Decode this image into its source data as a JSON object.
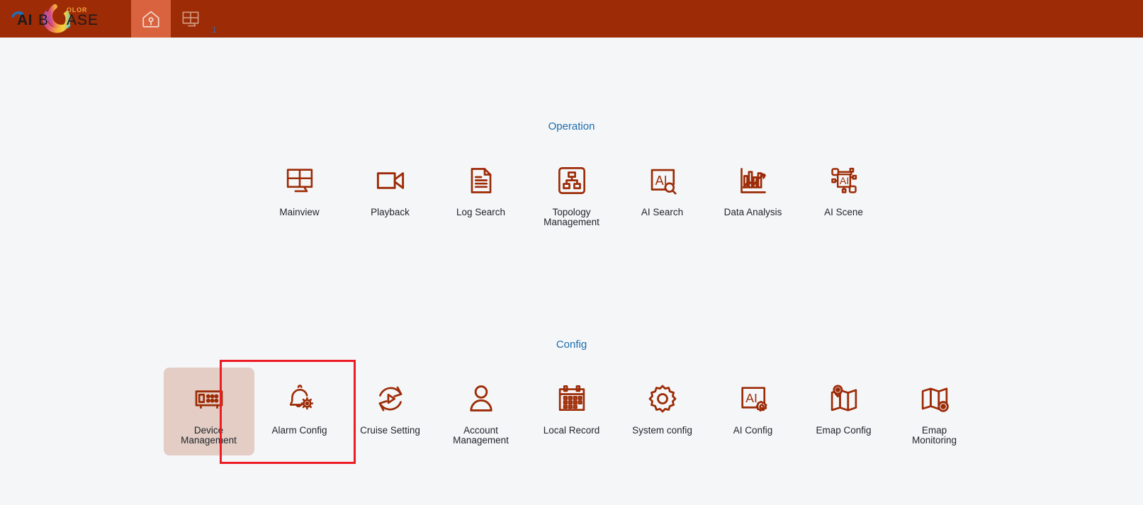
{
  "app": {
    "brand_primary": "#9c2b06",
    "brand_active_tab": "#d9633f",
    "accent_heading": "#1b6daf",
    "icon_color": "#9c2b06",
    "page_background": "#f5f6f8",
    "highlight_tile_bg": "#e3cdc4",
    "annotation_color": "#ed1c24",
    "logo_text_main": "AIBASE",
    "logo_text_sub": "OLOR"
  },
  "topbar": {
    "tabs": [
      {
        "name": "home-tab",
        "icon": "home-icon",
        "active": true,
        "badge": ""
      },
      {
        "name": "mainview-tab",
        "icon": "grid-monitor-icon",
        "active": false,
        "badge": "1"
      }
    ]
  },
  "sections": [
    {
      "id": "operation",
      "title": "Operation",
      "tiles": [
        {
          "label": "Mainview",
          "icon": "grid-monitor-icon",
          "highlight": false
        },
        {
          "label": "Playback",
          "icon": "video-camera-icon",
          "highlight": false
        },
        {
          "label": "Log Search",
          "icon": "document-lines-icon",
          "highlight": false
        },
        {
          "label": "Topology\nManagement",
          "icon": "topology-icon",
          "highlight": false
        },
        {
          "label": "AI Search",
          "icon": "ai-search-icon",
          "highlight": false
        },
        {
          "label": "Data Analysis",
          "icon": "data-analysis-icon",
          "highlight": false
        },
        {
          "label": "AI Scene",
          "icon": "ai-scene-icon",
          "highlight": false
        }
      ]
    },
    {
      "id": "config",
      "title": "Config",
      "tiles": [
        {
          "label": "Device\nManagement",
          "icon": "device-rack-icon",
          "highlight": true
        },
        {
          "label": "Alarm Config",
          "icon": "bell-gear-icon",
          "highlight": false
        },
        {
          "label": "Cruise Setting",
          "icon": "cruise-play-icon",
          "highlight": false
        },
        {
          "label": "Account\nManagement",
          "icon": "person-icon",
          "highlight": false
        },
        {
          "label": "Local Record",
          "icon": "calendar-icon",
          "highlight": false
        },
        {
          "label": "System config",
          "icon": "gear-icon",
          "highlight": false
        },
        {
          "label": "AI Config",
          "icon": "ai-gear-icon",
          "highlight": false
        },
        {
          "label": "Emap Config",
          "icon": "map-pin-icon",
          "highlight": false
        },
        {
          "label": "Emap\nMonitoring",
          "icon": "map-eye-icon",
          "highlight": false
        }
      ]
    }
  ],
  "annotation": {
    "name": "device-management-highlight-box",
    "target_label": "Device Management"
  }
}
